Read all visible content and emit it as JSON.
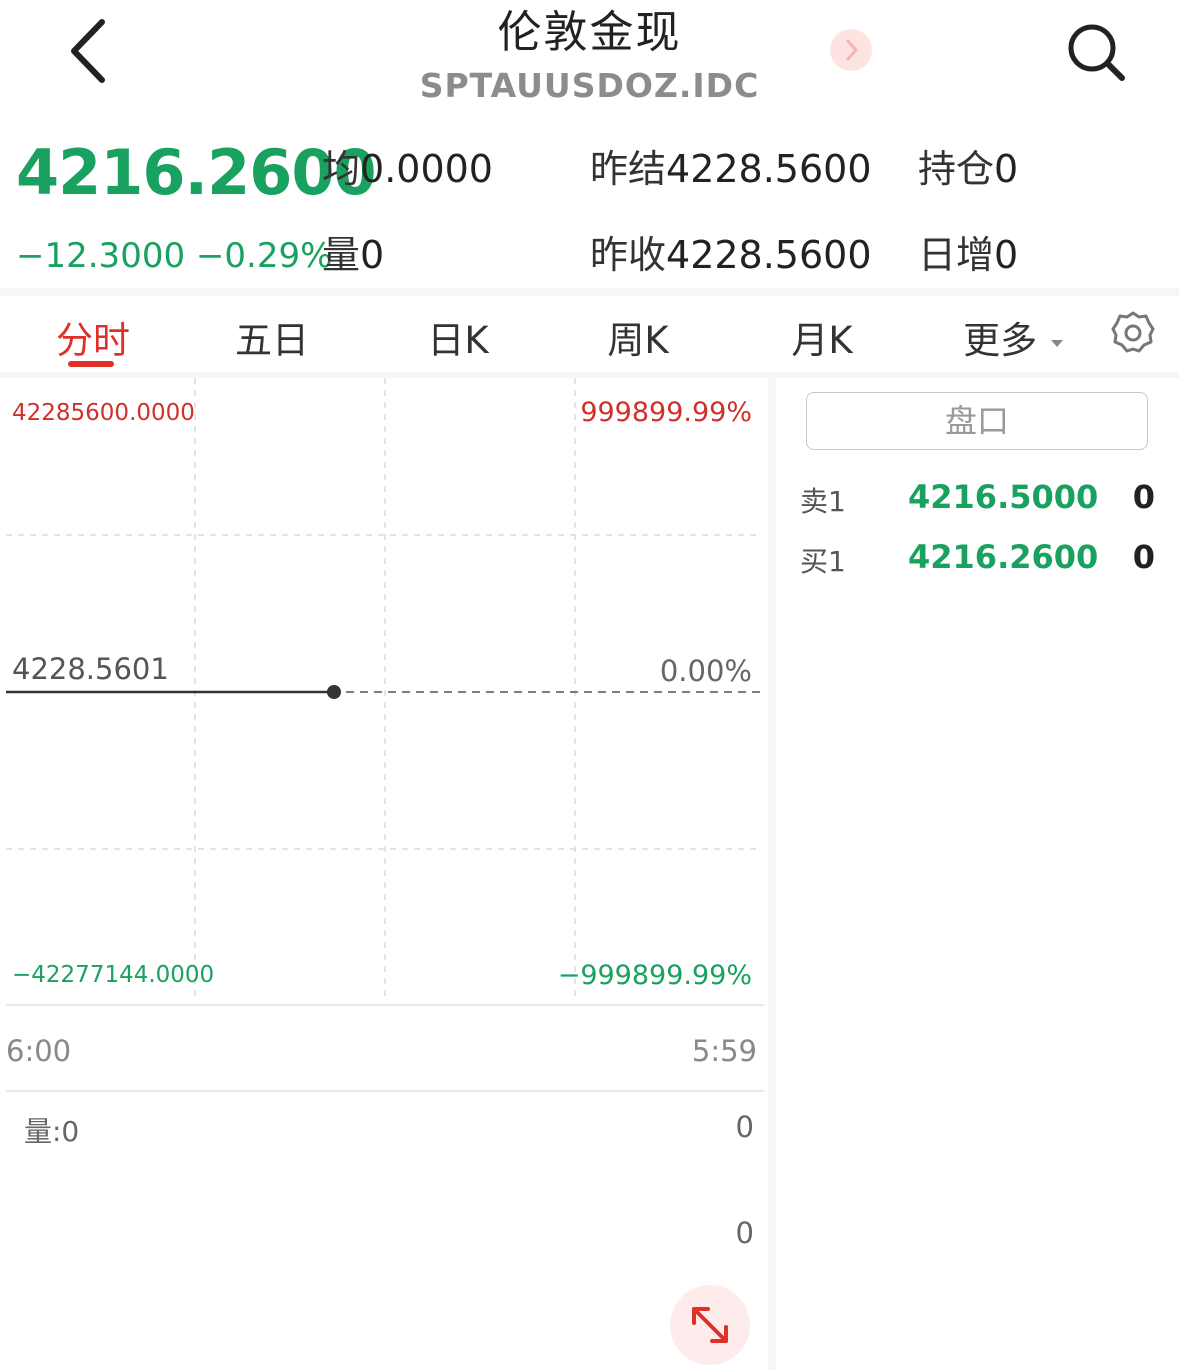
{
  "header": {
    "title": "伦敦金现",
    "subtitle": "SPTAUUSDOZ.IDC"
  },
  "quote": {
    "price": "4216.2600",
    "change": "−12.3000 −0.29%",
    "avg_label": "均",
    "avg_value": "0.0000",
    "volume_label": "量",
    "volume_value": "0",
    "prev_settle_label": "昨结",
    "prev_settle_value": "4228.5600",
    "prev_close_label": "昨收",
    "prev_close_value": "4228.5600",
    "open_interest_label": "持仓",
    "open_interest_value": "0",
    "oi_change_label": "日增",
    "oi_change_value": "0"
  },
  "tabs": [
    {
      "label": "分时"
    },
    {
      "label": "五日"
    },
    {
      "label": "日K"
    },
    {
      "label": "周K"
    },
    {
      "label": "月K"
    },
    {
      "label": "更多"
    }
  ],
  "chart": {
    "y_top_left": "42285600.0000",
    "y_top_right": "999899.99%",
    "y_mid_left": "4228.5601",
    "y_mid_right": "0.00%",
    "y_bot_left": "−42277144.0000",
    "y_bot_right": "−999899.99%",
    "time_start": "6:00",
    "time_end": "5:59",
    "volume_label": "量:0",
    "volume_max": "0",
    "volume_min": "0"
  },
  "order_book": {
    "button_label": "盘口",
    "ask_label": "卖1",
    "ask_price": "4216.5000",
    "ask_qty": "0",
    "bid_label": "买1",
    "bid_price": "4216.2600",
    "bid_qty": "0"
  },
  "colors": {
    "up": "#d0302a",
    "down": "#19a15f",
    "accent": "#e0302a"
  }
}
